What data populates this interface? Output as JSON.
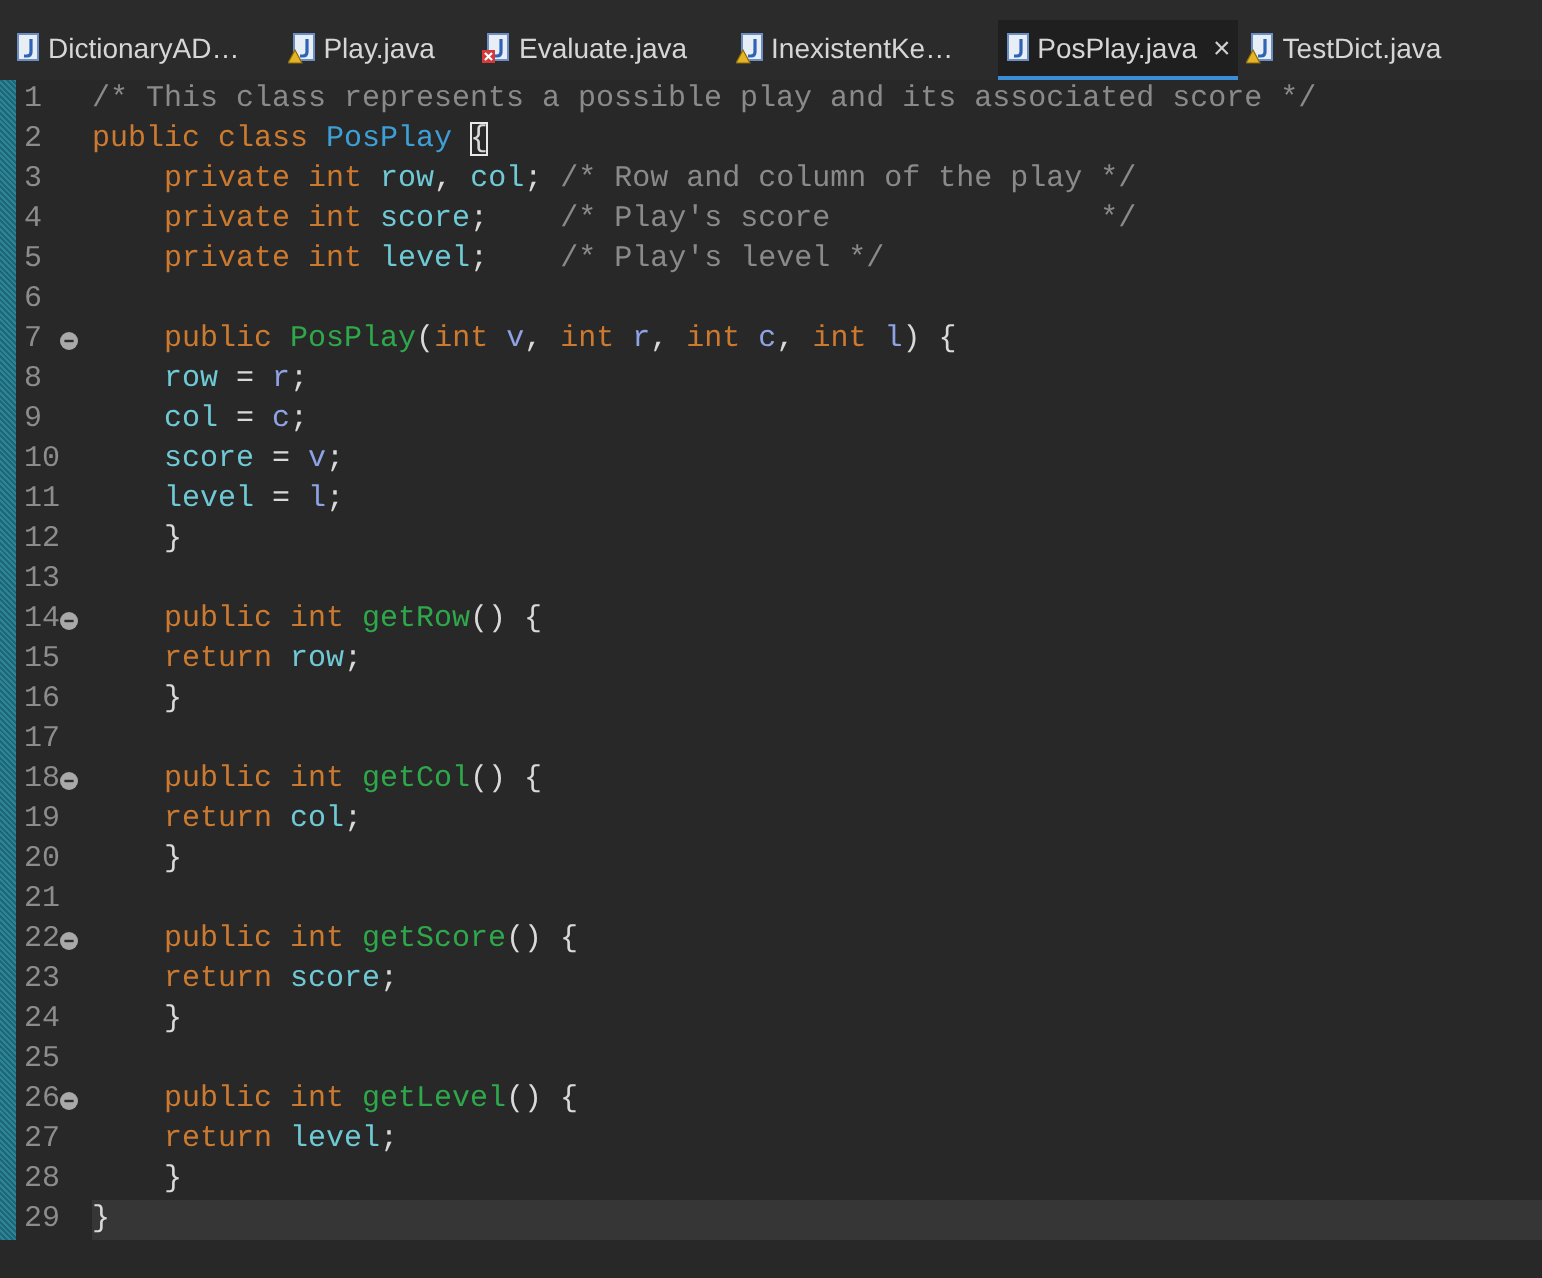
{
  "tabs": [
    {
      "label": "DictionaryAD…",
      "kind": "plain",
      "selected": false
    },
    {
      "label": "Play.java",
      "kind": "warning",
      "selected": false
    },
    {
      "label": "Evaluate.java",
      "kind": "error",
      "selected": false
    },
    {
      "label": "InexistentKe…",
      "kind": "warning",
      "selected": false
    },
    {
      "label": "PosPlay.java",
      "kind": "plain",
      "selected": true,
      "close": "×"
    },
    {
      "label": "TestDict.java",
      "kind": "warning",
      "selected": false
    }
  ],
  "editor": {
    "lines": [
      {
        "number": "1",
        "fold": false,
        "current": false,
        "tokens": [
          {
            "kind": "comment",
            "text": "/* This class represents a possible play and its associated score */"
          }
        ]
      },
      {
        "number": "2",
        "fold": false,
        "current": false,
        "tokens": [
          {
            "kind": "keyword",
            "text": "public class "
          },
          {
            "kind": "class",
            "text": "PosPlay "
          },
          {
            "kind": "bracket",
            "text": "{"
          }
        ]
      },
      {
        "number": "3",
        "fold": false,
        "current": false,
        "tokens": [
          {
            "kind": "keyword",
            "text": "    private int "
          },
          {
            "kind": "field",
            "text": "row"
          },
          {
            "kind": "plain",
            "text": ", "
          },
          {
            "kind": "field",
            "text": "col"
          },
          {
            "kind": "plain",
            "text": "; "
          },
          {
            "kind": "comment",
            "text": "/* Row and column of the play */"
          }
        ]
      },
      {
        "number": "4",
        "fold": false,
        "current": false,
        "tokens": [
          {
            "kind": "keyword",
            "text": "    private int "
          },
          {
            "kind": "field",
            "text": "score"
          },
          {
            "kind": "plain",
            "text": ";    "
          },
          {
            "kind": "comment",
            "text": "/* Play's score               */"
          }
        ]
      },
      {
        "number": "5",
        "fold": false,
        "current": false,
        "tokens": [
          {
            "kind": "keyword",
            "text": "    private int "
          },
          {
            "kind": "field",
            "text": "level"
          },
          {
            "kind": "plain",
            "text": ";    "
          },
          {
            "kind": "comment",
            "text": "/* Play's level */"
          }
        ]
      },
      {
        "number": "6",
        "fold": false,
        "current": false
      },
      {
        "number": "7",
        "fold": true,
        "current": false,
        "tokens": [
          {
            "kind": "keyword",
            "text": "    public "
          },
          {
            "kind": "method",
            "text": "PosPlay"
          },
          {
            "kind": "plain",
            "text": "("
          },
          {
            "kind": "keyword",
            "text": "int "
          },
          {
            "kind": "param",
            "text": "v"
          },
          {
            "kind": "plain",
            "text": ", "
          },
          {
            "kind": "keyword",
            "text": "int "
          },
          {
            "kind": "param",
            "text": "r"
          },
          {
            "kind": "plain",
            "text": ", "
          },
          {
            "kind": "keyword",
            "text": "int "
          },
          {
            "kind": "param",
            "text": "c"
          },
          {
            "kind": "plain",
            "text": ", "
          },
          {
            "kind": "keyword",
            "text": "int "
          },
          {
            "kind": "param",
            "text": "l"
          },
          {
            "kind": "plain",
            "text": ") {"
          }
        ]
      },
      {
        "number": "8",
        "fold": false,
        "current": false,
        "tokens": [
          {
            "kind": "field",
            "text": "    row"
          },
          {
            "kind": "plain",
            "text": " = "
          },
          {
            "kind": "param",
            "text": "r"
          },
          {
            "kind": "plain",
            "text": ";"
          }
        ]
      },
      {
        "number": "9",
        "fold": false,
        "current": false,
        "tokens": [
          {
            "kind": "field",
            "text": "    col"
          },
          {
            "kind": "plain",
            "text": " = "
          },
          {
            "kind": "param",
            "text": "c"
          },
          {
            "kind": "plain",
            "text": ";"
          }
        ]
      },
      {
        "number": "10",
        "fold": false,
        "current": false,
        "tokens": [
          {
            "kind": "field",
            "text": "    score"
          },
          {
            "kind": "plain",
            "text": " = "
          },
          {
            "kind": "param",
            "text": "v"
          },
          {
            "kind": "plain",
            "text": ";"
          }
        ]
      },
      {
        "number": "11",
        "fold": false,
        "current": false,
        "tokens": [
          {
            "kind": "field",
            "text": "    level"
          },
          {
            "kind": "plain",
            "text": " = "
          },
          {
            "kind": "param",
            "text": "l"
          },
          {
            "kind": "plain",
            "text": ";"
          }
        ]
      },
      {
        "number": "12",
        "fold": false,
        "current": false,
        "tokens": [
          {
            "kind": "plain",
            "text": "    }"
          }
        ]
      },
      {
        "number": "13",
        "fold": false,
        "current": false
      },
      {
        "number": "14",
        "fold": true,
        "current": false,
        "tokens": [
          {
            "kind": "keyword",
            "text": "    public int "
          },
          {
            "kind": "method",
            "text": "getRow"
          },
          {
            "kind": "plain",
            "text": "() {"
          }
        ]
      },
      {
        "number": "15",
        "fold": false,
        "current": false,
        "tokens": [
          {
            "kind": "keyword",
            "text": "    return "
          },
          {
            "kind": "field",
            "text": "row"
          },
          {
            "kind": "plain",
            "text": ";"
          }
        ]
      },
      {
        "number": "16",
        "fold": false,
        "current": false,
        "tokens": [
          {
            "kind": "plain",
            "text": "    }"
          }
        ]
      },
      {
        "number": "17",
        "fold": false,
        "current": false
      },
      {
        "number": "18",
        "fold": true,
        "current": false,
        "tokens": [
          {
            "kind": "keyword",
            "text": "    public int "
          },
          {
            "kind": "method",
            "text": "getCol"
          },
          {
            "kind": "plain",
            "text": "() {"
          }
        ]
      },
      {
        "number": "19",
        "fold": false,
        "current": false,
        "tokens": [
          {
            "kind": "keyword",
            "text": "    return "
          },
          {
            "kind": "field",
            "text": "col"
          },
          {
            "kind": "plain",
            "text": ";"
          }
        ]
      },
      {
        "number": "20",
        "fold": false,
        "current": false,
        "tokens": [
          {
            "kind": "plain",
            "text": "    }"
          }
        ]
      },
      {
        "number": "21",
        "fold": false,
        "current": false
      },
      {
        "number": "22",
        "fold": true,
        "current": false,
        "tokens": [
          {
            "kind": "keyword",
            "text": "    public int "
          },
          {
            "kind": "method",
            "text": "getScore"
          },
          {
            "kind": "plain",
            "text": "() {"
          }
        ]
      },
      {
        "number": "23",
        "fold": false,
        "current": false,
        "tokens": [
          {
            "kind": "keyword",
            "text": "    return "
          },
          {
            "kind": "field",
            "text": "score"
          },
          {
            "kind": "plain",
            "text": ";"
          }
        ]
      },
      {
        "number": "24",
        "fold": false,
        "current": false,
        "tokens": [
          {
            "kind": "plain",
            "text": "    }"
          }
        ]
      },
      {
        "number": "25",
        "fold": false,
        "current": false
      },
      {
        "number": "26",
        "fold": true,
        "current": false,
        "tokens": [
          {
            "kind": "keyword",
            "text": "    public int "
          },
          {
            "kind": "method",
            "text": "getLevel"
          },
          {
            "kind": "plain",
            "text": "() {"
          }
        ]
      },
      {
        "number": "27",
        "fold": false,
        "current": false,
        "tokens": [
          {
            "kind": "keyword",
            "text": "    return "
          },
          {
            "kind": "field",
            "text": "level"
          },
          {
            "kind": "plain",
            "text": ";"
          }
        ]
      },
      {
        "number": "28",
        "fold": false,
        "current": false,
        "tokens": [
          {
            "kind": "plain",
            "text": "    }"
          }
        ]
      },
      {
        "number": "29",
        "fold": false,
        "current": true,
        "tokens": [
          {
            "kind": "plain",
            "text": "}"
          }
        ]
      }
    ]
  }
}
